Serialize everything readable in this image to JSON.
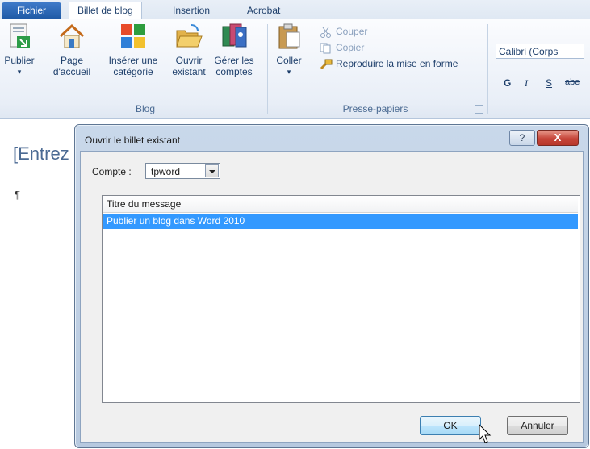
{
  "tabs": [
    {
      "label": "Fichier"
    },
    {
      "label": "Billet de blog"
    },
    {
      "label": "Insertion"
    },
    {
      "label": "Acrobat"
    }
  ],
  "ribbon": {
    "blog": {
      "publish": "Publier",
      "home_1": "Page",
      "home_2": "d'accueil",
      "insert_cat_1": "Insérer une",
      "insert_cat_2": "catégorie",
      "open_1": "Ouvrir",
      "open_2": "existant",
      "manage_1": "Gérer les",
      "manage_2": "comptes",
      "group_label": "Blog"
    },
    "clipboard": {
      "paste": "Coller",
      "cut": "Couper",
      "copy": "Copier",
      "format_painter": "Reproduire la mise en forme",
      "group_label": "Presse-papiers"
    },
    "font": {
      "font_name": "Calibri (Corps",
      "bold": "G",
      "italic": "I",
      "underline": "S",
      "strike": "abe"
    }
  },
  "document": {
    "title_placeholder": "[Entrez",
    "pilcrow": "¶"
  },
  "dialog": {
    "title": "Ouvrir le billet existant",
    "help": "?",
    "close": "X",
    "account_label": "Compte :",
    "account_value": "tpword",
    "list_header": "Titre du message",
    "rows": [
      "Publier un blog dans Word 2010"
    ],
    "ok": "OK",
    "cancel": "Annuler"
  }
}
